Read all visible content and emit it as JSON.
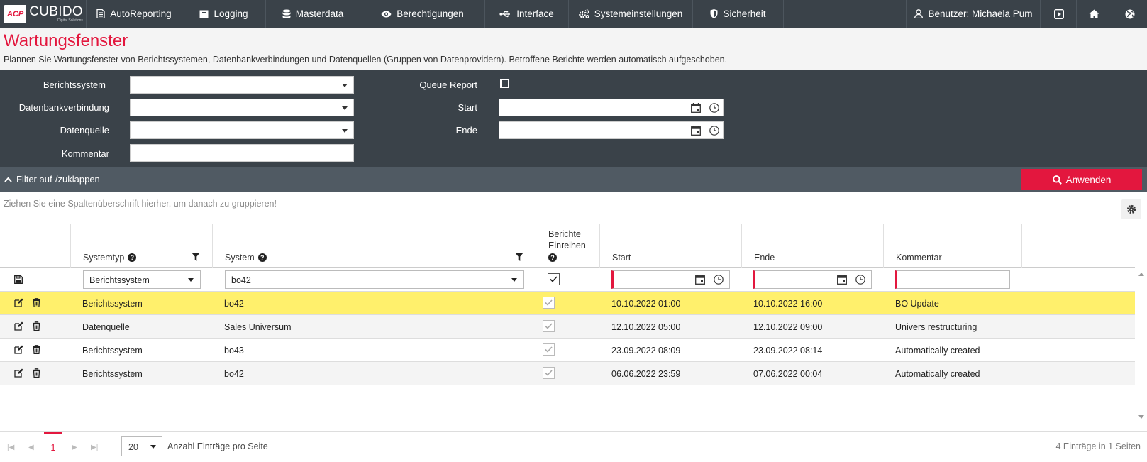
{
  "app": {
    "logo_mark": "ACP",
    "logo_name": "CUBIDO",
    "logo_tagline": "Digital Solutions"
  },
  "nav": {
    "items": [
      {
        "label": "AutoReporting",
        "icon": "document-icon"
      },
      {
        "label": "Logging",
        "icon": "box-icon"
      },
      {
        "label": "Masterdata",
        "icon": "database-icon"
      },
      {
        "label": "Berechtigungen",
        "icon": "eye-icon"
      },
      {
        "label": "Interface",
        "icon": "usb-icon"
      },
      {
        "label": "Systemeinstellungen",
        "icon": "cogs-icon"
      },
      {
        "label": "Sicherheit",
        "icon": "shield-icon"
      }
    ],
    "user_label": "Benutzer: Michaela Pum"
  },
  "page": {
    "title": "Wartungsfenster",
    "description": "Plannen Sie Wartungsfenster von Berichtssystemen, Datenbankverbindungen und Datenquellen (Gruppen von Datenprovidern). Betroffene Berichte werden automatisch aufgeschoben."
  },
  "filter": {
    "berichtssystem_label": "Berichtssystem",
    "datenbankverbindung_label": "Datenbankverbindung",
    "datenquelle_label": "Datenquelle",
    "kommentar_label": "Kommentar",
    "queue_label": "Queue Report",
    "start_label": "Start",
    "ende_label": "Ende",
    "toggle_label": "Filter auf-/zuklappen",
    "apply_label": "Anwenden"
  },
  "grid": {
    "group_hint": "Ziehen Sie eine Spaltenüberschrift hierher, um danach zu gruppieren!",
    "columns": {
      "systemtyp": "Systemtyp",
      "system": "System",
      "berichte_1": "Berichte",
      "berichte_2": "Einreihen",
      "start": "Start",
      "ende": "Ende",
      "kommentar": "Kommentar"
    },
    "edit_row": {
      "systemtyp": "Berichtssystem",
      "system": "bo42",
      "queue_checked": true
    },
    "rows": [
      {
        "systemtyp": "Berichtssystem",
        "system": "bo42",
        "start": "10.10.2022 01:00",
        "ende": "10.10.2022 16:00",
        "kommentar": "BO Update",
        "highlight": true
      },
      {
        "systemtyp": "Datenquelle",
        "system": "Sales Universum",
        "start": "12.10.2022 05:00",
        "ende": "12.10.2022 09:00",
        "kommentar": "Univers restructuring",
        "highlight": false
      },
      {
        "systemtyp": "Berichtssystem",
        "system": "bo43",
        "start": "23.09.2022 08:09",
        "ende": "23.09.2022 08:14",
        "kommentar": "Automatically created",
        "highlight": false
      },
      {
        "systemtyp": "Berichtssystem",
        "system": "bo42",
        "start": "06.06.2022 23:59",
        "ende": "07.06.2022 00:04",
        "kommentar": "Automatically created",
        "highlight": false
      }
    ]
  },
  "pager": {
    "current_page": "1",
    "page_size": "20",
    "page_size_label": "Anzahl Einträge pro Seite",
    "info": "4 Einträge in 1 Seiten"
  },
  "colors": {
    "accent": "#e3173e",
    "nav_bg": "#3a4249",
    "highlight_row": "#fff06c",
    "alt_row": "#f4f4f4"
  }
}
